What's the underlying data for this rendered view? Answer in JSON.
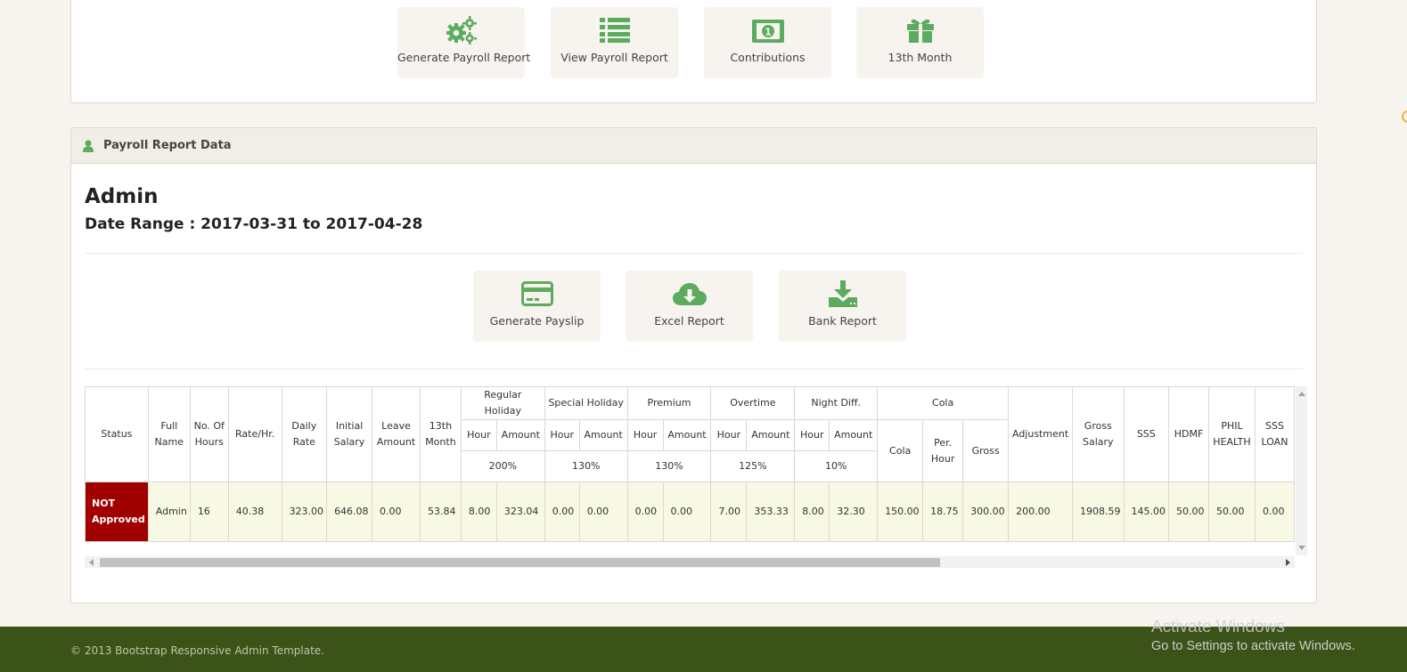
{
  "top_actions": [
    {
      "label": "Generate Payroll Report",
      "icon": "gears-icon"
    },
    {
      "label": "View Payroll Report",
      "icon": "list-icon"
    },
    {
      "label": "Contributions",
      "icon": "money-icon"
    },
    {
      "label": "13th Month",
      "icon": "gift-icon"
    }
  ],
  "panel": {
    "title": "Payroll Report Data",
    "icon": "user-icon"
  },
  "report": {
    "name": "Admin",
    "date_range": "Date Range : 2017-03-31 to 2017-04-28"
  },
  "report_actions": [
    {
      "label": "Generate Payslip",
      "icon": "credit-card-icon"
    },
    {
      "label": "Excel Report",
      "icon": "cloud-download-icon"
    },
    {
      "label": "Bank Report",
      "icon": "download-icon"
    }
  ],
  "table": {
    "headers": {
      "status": "Status",
      "full_name": "Full Name",
      "no_of_hours": "No. Of Hours",
      "rate_hr": "Rate/Hr.",
      "daily_rate": "Daily Rate",
      "initial_salary": "Initial Salary",
      "leave_amount": "Leave Amount",
      "thirteenth_month": "13th Month",
      "regular_holiday": "Regular Holiday",
      "special_holiday": "Special Holiday",
      "premium": "Premium",
      "overtime": "Overtime",
      "night_diff": "Night Diff.",
      "cola": "Cola",
      "hour": "Hour",
      "amount": "Amount",
      "cola_sub": "Cola",
      "per_hour": "Per. Hour",
      "gross": "Gross",
      "adjustment": "Adjustment",
      "gross_salary": "Gross Salary",
      "sss": "SSS",
      "hdmf": "HDMF",
      "phil_health": "PHIL HEALTH",
      "sss_loan": "SSS LOAN"
    },
    "rates": {
      "regular": "200%",
      "special": "130%",
      "premium": "130%",
      "overtime": "125%",
      "night": "10%"
    },
    "rows": [
      {
        "status": "NOT Approved",
        "full_name": "Admin",
        "no_of_hours": "16",
        "rate_hr": "40.38",
        "daily_rate": "323.00",
        "initial_salary": "646.08",
        "leave_amount": "0.00",
        "thirteenth_month": "53.84",
        "reg_hour": "8.00",
        "reg_amount": "323.04",
        "spec_hour": "0.00",
        "spec_amount": "0.00",
        "prem_hour": "0.00",
        "prem_amount": "0.00",
        "ot_hour": "7.00",
        "ot_amount": "353.33",
        "nd_hour": "8.00",
        "nd_amount": "32.30",
        "cola": "150.00",
        "cola_per_hour": "18.75",
        "cola_gross": "300.00",
        "adjustment": "200.00",
        "gross_salary": "1908.59",
        "sss": "145.00",
        "hdmf": "50.00",
        "phil_health": "50.00",
        "sss_loan": "0.00"
      }
    ]
  },
  "footer": {
    "copyright": "© 2013 Bootstrap Responsive Admin Template."
  },
  "watermark": {
    "line1": "Activate Windows",
    "line2": "Go to Settings to activate Windows."
  },
  "colors": {
    "accent": "#5cab5e",
    "status_bg": "#a10000",
    "footer_bg": "#3b5319",
    "row_bg": "#f8f9e4"
  }
}
